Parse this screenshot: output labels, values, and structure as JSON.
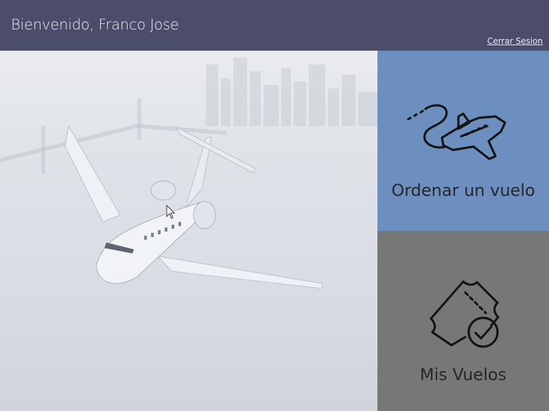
{
  "header": {
    "welcome": "Bienvenido, Franco Jose",
    "logout_label": "Cerrar Sesion"
  },
  "tiles": {
    "order": {
      "label": "Ordenar un vuelo",
      "icon": "airplane-route-icon"
    },
    "flights": {
      "label": "Mis Vuelos",
      "icon": "ticket-check-icon"
    }
  },
  "hero": {
    "image": "private-jet-over-city-photo"
  },
  "colors": {
    "header_bg": "#4c4d6b",
    "order_tile_bg": "#6d8fbf",
    "flights_tile_bg": "#777777"
  }
}
